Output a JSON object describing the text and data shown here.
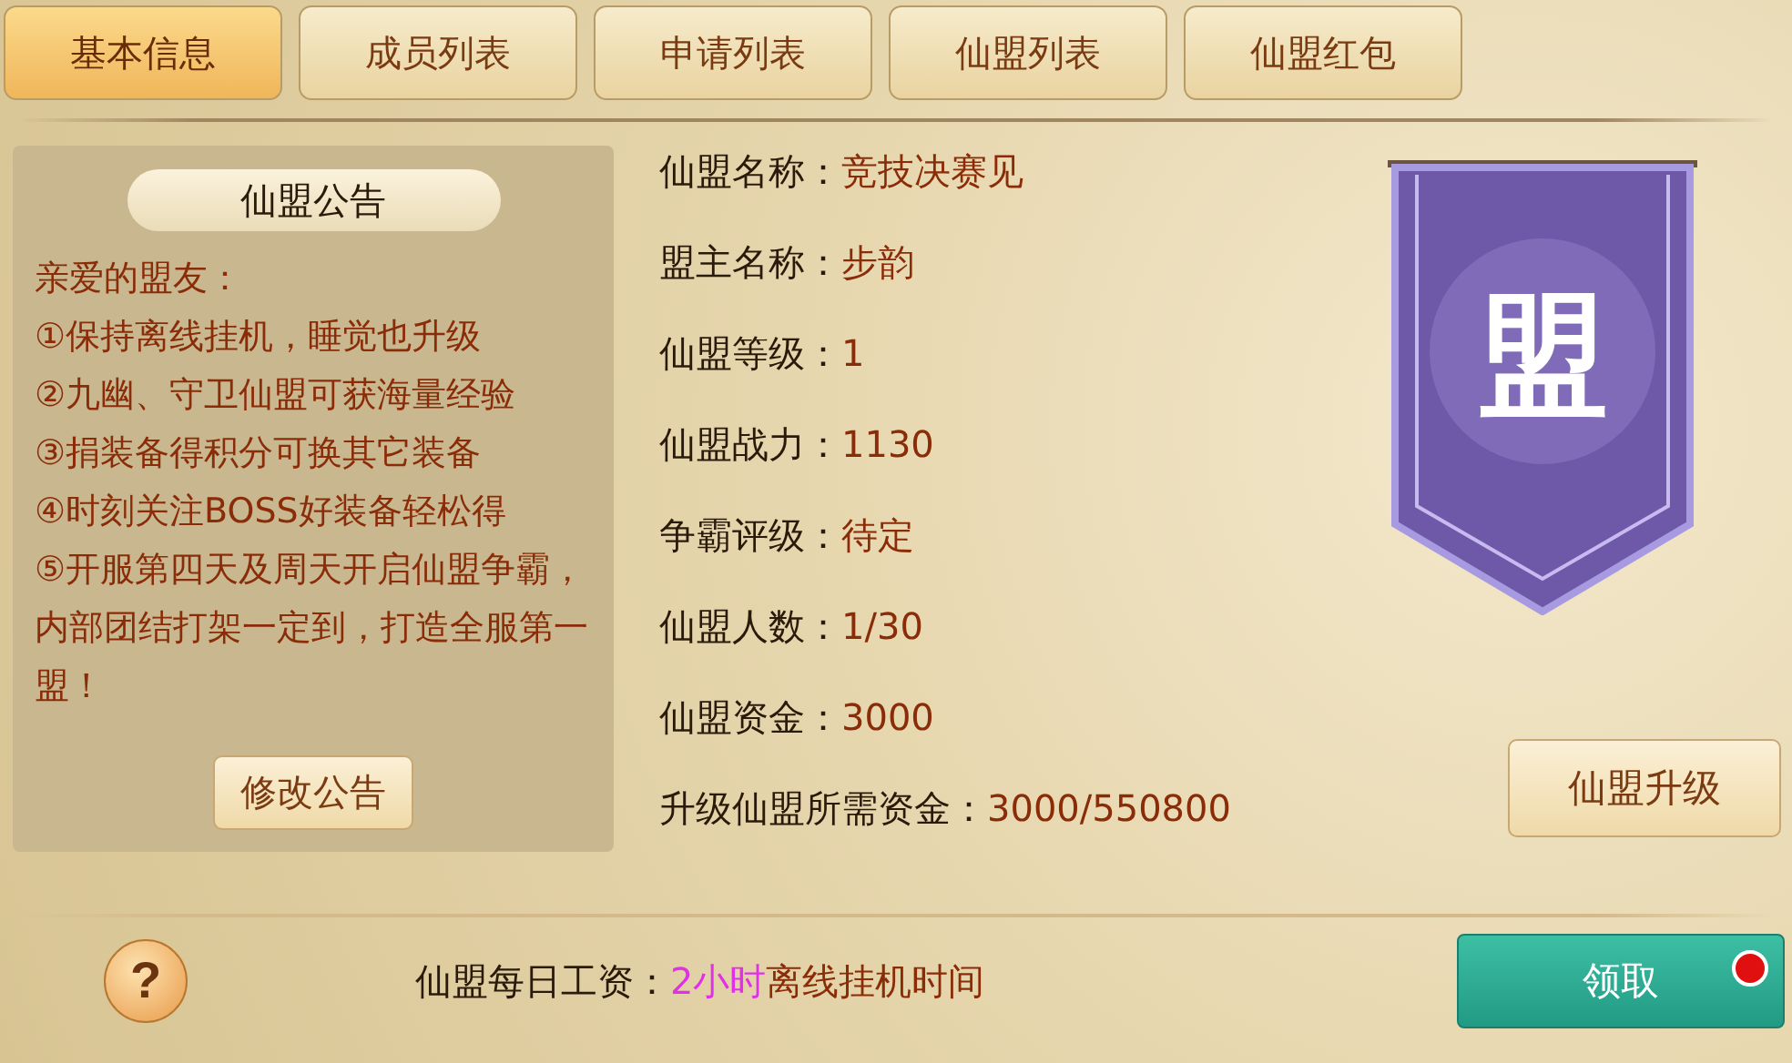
{
  "tabs": [
    {
      "label": "基本信息",
      "selected": true
    },
    {
      "label": "成员列表",
      "selected": false
    },
    {
      "label": "申请列表",
      "selected": false
    },
    {
      "label": "仙盟列表",
      "selected": false
    },
    {
      "label": "仙盟红包",
      "selected": false
    }
  ],
  "notice": {
    "title": "仙盟公告",
    "lines": [
      "亲爱的盟友：",
      "①保持离线挂机，睡觉也升级",
      "②九幽、守卫仙盟可获海量经验",
      "③捐装备得积分可换其它装备",
      "④时刻关注BOSS好装备轻松得",
      "⑤开服第四天及周天开启仙盟争霸，内部团结打架一定到，打造全服第一盟！"
    ],
    "edit_button": "修改公告"
  },
  "info": [
    {
      "label": "仙盟名称：",
      "value": "竞技决赛见"
    },
    {
      "label": "盟主名称：",
      "value": "步韵"
    },
    {
      "label": "仙盟等级：",
      "value": "1"
    },
    {
      "label": "仙盟战力：",
      "value": "1130"
    },
    {
      "label": "争霸评级：",
      "value": "待定"
    },
    {
      "label": "仙盟人数：",
      "value": "1/30"
    },
    {
      "label": "仙盟资金：",
      "value": "3000"
    },
    {
      "label": "升级仙盟所需资金：",
      "value": "3000/550800"
    }
  ],
  "banner": {
    "emblem": "盟"
  },
  "upgrade_button": "仙盟升级",
  "help_button": "?",
  "salary": {
    "label": "仙盟每日工资：",
    "highlight": "2小时",
    "rest": "离线挂机时间"
  },
  "claim_button": {
    "label": "领取",
    "has_notice": true
  }
}
